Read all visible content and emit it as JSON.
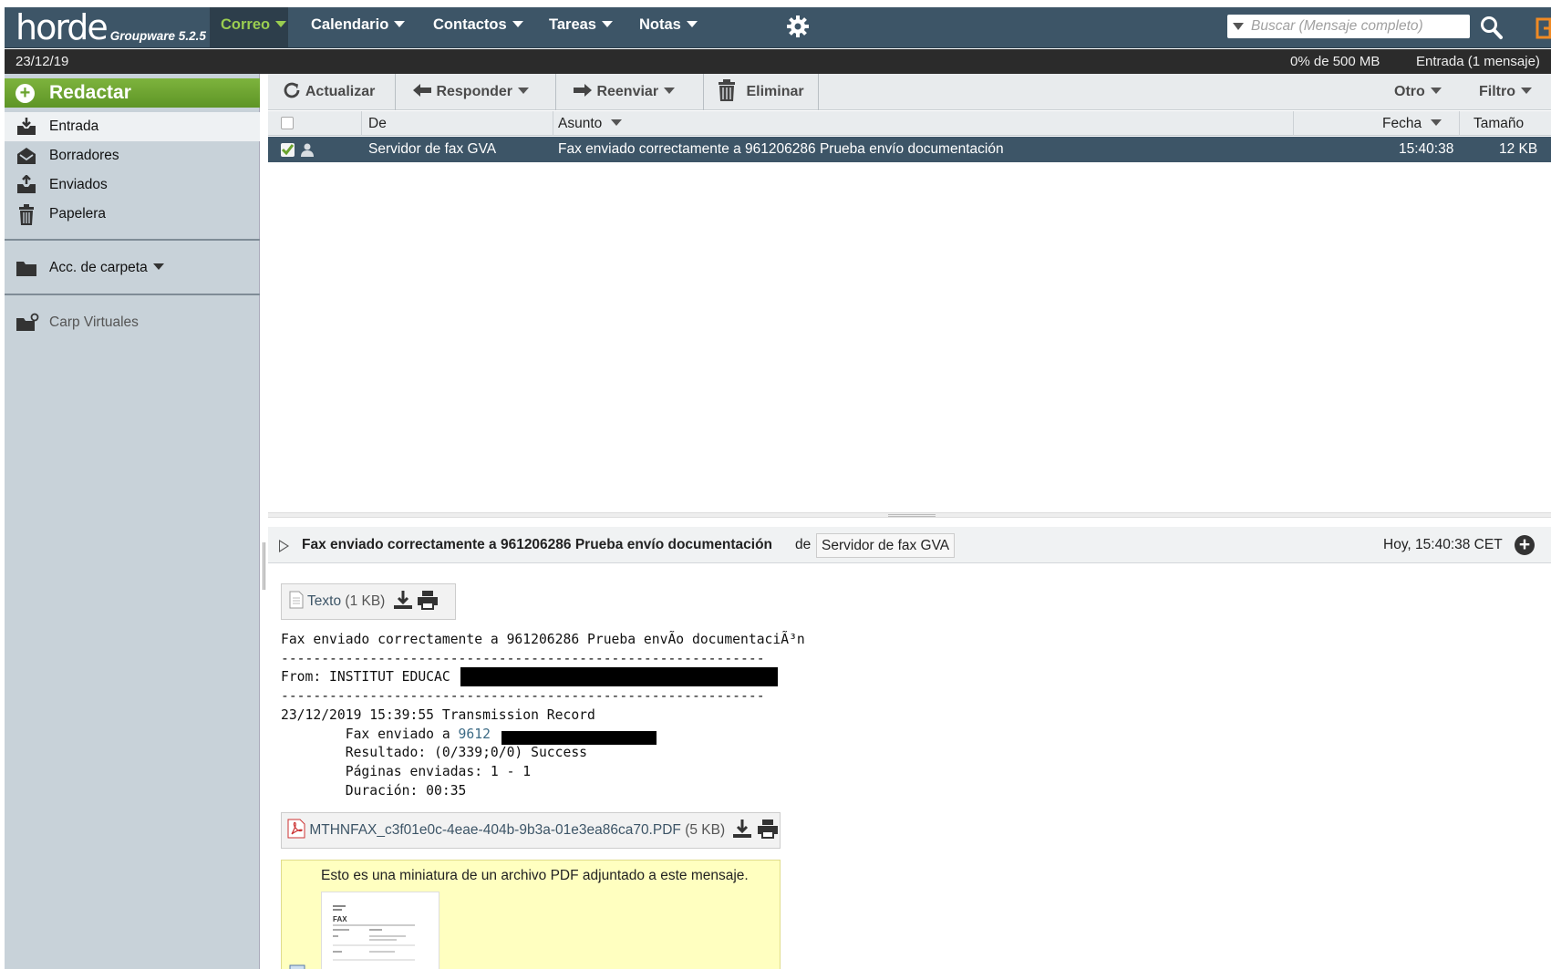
{
  "brand": {
    "name": "horde",
    "sub": "Groupware 5.2.5"
  },
  "menu": [
    {
      "label": "Correo",
      "active": true
    },
    {
      "label": "Calendario"
    },
    {
      "label": "Contactos"
    },
    {
      "label": "Tareas"
    },
    {
      "label": "Notas"
    }
  ],
  "search": {
    "placeholder": "Buscar (Mensaje completo)"
  },
  "subbar": {
    "date": "23/12/19",
    "quota": "0% de 500 MB",
    "folder_info": "Entrada (1 mensaje)"
  },
  "sidebar": {
    "compose": "Redactar",
    "folders": [
      "Entrada",
      "Borradores",
      "Enviados",
      "Papelera"
    ],
    "folder_actions": "Acc. de carpeta",
    "virtual": "Carp Virtuales"
  },
  "toolbar": {
    "refresh": "Actualizar",
    "reply": "Responder",
    "forward": "Reenviar",
    "delete": "Eliminar",
    "other": "Otro",
    "filter": "Filtro"
  },
  "list": {
    "headers": {
      "from": "De",
      "subject": "Asunto",
      "date": "Fecha",
      "size": "Tamaño"
    },
    "rows": [
      {
        "from": "Servidor de fax GVA",
        "subject": "Fax enviado correctamente a 961206286 Prueba envío documentación",
        "date": "15:40:38",
        "size": "12 KB"
      }
    ]
  },
  "preview": {
    "subject": "Fax enviado correctamente a 961206286 Prueba envío documentación",
    "de": "de",
    "from": "Servidor de fax GVA",
    "date": "Hoy, 15:40:38 CET",
    "part1": {
      "name": "Texto",
      "size": "(1 KB)"
    },
    "text": {
      "l1": "Fax enviado correctamente a 961206286 Prueba envÃo documentaciÃ³n",
      "l2": "------------------------------------------------------------",
      "l3": "From: INSTITUT EDUCAC",
      "l4": "------------------------------------------------------------",
      "l5": "23/12/2019 15:39:55 Transmission Record",
      "l6a": "        Fax enviado a ",
      "l6b": "9612",
      "l7": "        Resultado: (0/339;0/0) Success",
      "l8": "        Páginas enviadas: 1 - 1",
      "l9": "        Duración: 00:35"
    },
    "part2": {
      "name": "MTHNFAX_c3f01e0c-4eae-404b-9b3a-01e3ea86ca70.PDF",
      "size": "(5 KB)"
    },
    "thumb_note": "Esto es una miniatura de un archivo PDF adjuntado a este mensaje.",
    "thumb_doc_title": "FAX"
  },
  "colors": {
    "topbar": "#3d5567",
    "active_menu": "#9acd50",
    "compose": "#6aa32e",
    "sidebar": "#c8d2d9",
    "selected_row": "#3d5567"
  }
}
